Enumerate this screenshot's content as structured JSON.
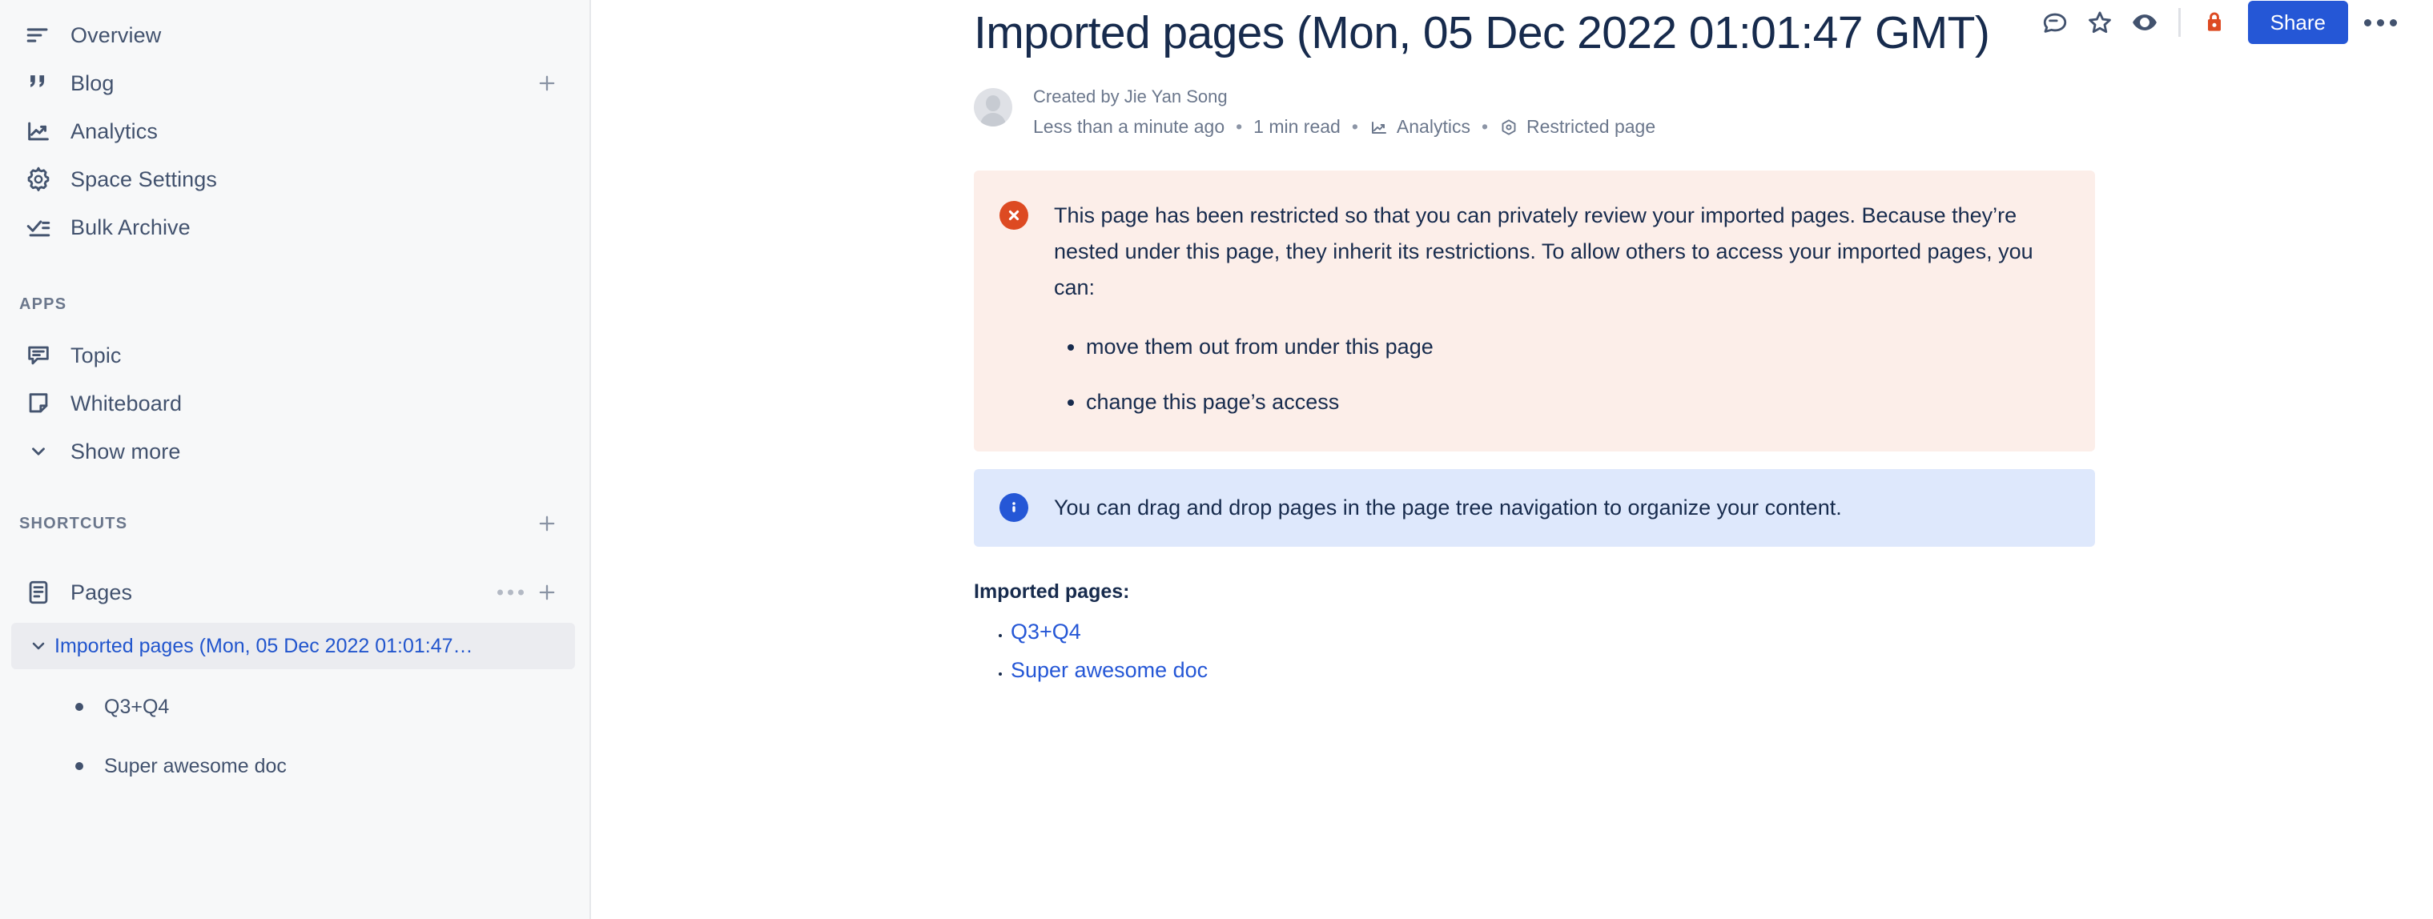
{
  "sidebar": {
    "nav_items": [
      {
        "label": "Overview",
        "icon": "overview-icon",
        "has_add": false
      },
      {
        "label": "Blog",
        "icon": "blog-quote-icon",
        "has_add": true
      },
      {
        "label": "Analytics",
        "icon": "analytics-chart-icon",
        "has_add": false
      },
      {
        "label": "Space Settings",
        "icon": "gear-icon",
        "has_add": false
      },
      {
        "label": "Bulk Archive",
        "icon": "bulk-archive-icon",
        "has_add": false
      }
    ],
    "apps_section": {
      "title": "APPS",
      "items": [
        {
          "label": "Topic",
          "icon": "topic-comment-icon"
        },
        {
          "label": "Whiteboard",
          "icon": "whiteboard-icon"
        }
      ],
      "show_more_label": "Show more"
    },
    "shortcuts_section": {
      "title": "SHORTCUTS"
    },
    "pages_section": {
      "label": "Pages",
      "icon": "pages-icon",
      "tree": [
        {
          "label": "Imported pages (Mon, 05 Dec 2022 01:01:47…",
          "selected": true,
          "depth": 0,
          "expanded": true
        },
        {
          "label": "Q3+Q4",
          "selected": false,
          "depth": 1
        },
        {
          "label": "Super awesome doc",
          "selected": false,
          "depth": 1
        }
      ]
    }
  },
  "header": {
    "actions": [
      {
        "name": "comment-icon",
        "label": "Comments"
      },
      {
        "name": "star-icon",
        "label": "Star"
      },
      {
        "name": "watch-eye-icon",
        "label": "Watch"
      }
    ],
    "lock_icon": "lock-icon",
    "share_label": "Share",
    "more_label": "More actions"
  },
  "page": {
    "title": "Imported pages (Mon, 05 Dec 2022 01:01:47 GMT)",
    "created_by": "Created by Jie Yan Song",
    "last_updated": "Less than a minute ago",
    "read_time": "1 min read",
    "analytics_label": "Analytics",
    "restriction_label": "Restricted page",
    "separator": "•"
  },
  "error_banner": {
    "icon": "error-cross-icon",
    "text": "This page has been restricted so that you can privately review your imported pages. Because they’re nested under this page, they inherit its restrictions. To allow others to access your imported pages, you can:",
    "bullets": [
      "move them out from under this page",
      "change this page’s access"
    ]
  },
  "info_banner": {
    "icon": "info-icon",
    "text": "You can drag and drop pages in the page tree navigation to organize your content."
  },
  "body": {
    "imported_pages_label": "Imported pages:",
    "links": [
      {
        "label": "Q3+Q4"
      },
      {
        "label": "Super awesome doc"
      }
    ]
  },
  "colors": {
    "brand_blue": "#2557D6",
    "link_blue": "#2155CD",
    "error_red": "#DD4A22",
    "lock_red": "#DD4A22",
    "error_bg": "#FCEEE9",
    "info_bg": "#DEE8FC",
    "sidebar_bg": "#F7F8F9",
    "selected_row": "#EBECF0",
    "text_dark": "#172B4D",
    "text_muted": "#6B778C"
  }
}
